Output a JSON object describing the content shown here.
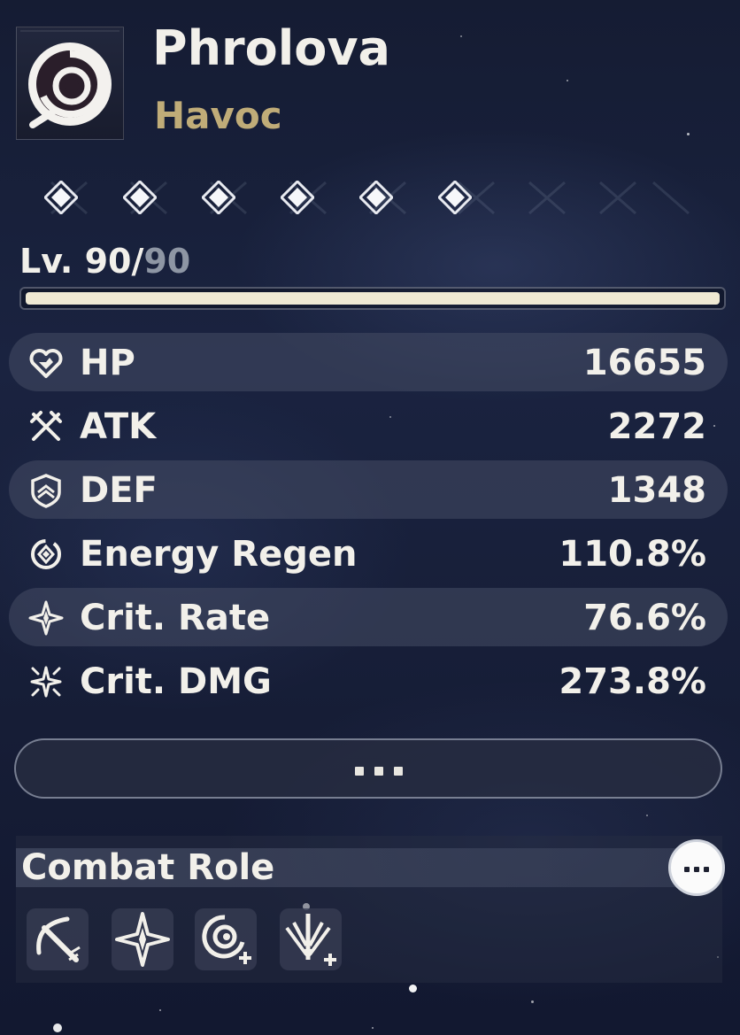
{
  "character": {
    "name": "Phrolova",
    "element": "Havoc",
    "element_icon": "havoc-swirl-icon"
  },
  "sequence": {
    "nodes_unlocked": 6,
    "icon": "diamond-icon"
  },
  "level": {
    "prefix": "Lv. ",
    "current": "90",
    "separator": "/",
    "max": "90",
    "progress": 1.0
  },
  "stats": [
    {
      "label": "HP",
      "value": "16655",
      "icon": "heart-icon",
      "shaded": true
    },
    {
      "label": "ATK",
      "value": "2272",
      "icon": "crossed-swords-icon",
      "shaded": false
    },
    {
      "label": "DEF",
      "value": "1348",
      "icon": "shield-icon",
      "shaded": true
    },
    {
      "label": "Energy Regen",
      "value": "110.8%",
      "icon": "energy-regen-icon",
      "shaded": false
    },
    {
      "label": "Crit. Rate",
      "value": "76.6%",
      "icon": "four-point-star-icon",
      "shaded": true
    },
    {
      "label": "Crit. DMG",
      "value": "273.8%",
      "icon": "burst-star-icon",
      "shaded": false
    }
  ],
  "more_button": {
    "label": "more-stats",
    "icon": "ellipsis-icon"
  },
  "combat_role": {
    "title": "Combat Role",
    "more_icon": "ellipsis-icon",
    "icons": [
      "sword-slash-icon",
      "sparkle-star-icon",
      "havoc-plus-icon",
      "downward-blade-plus-icon"
    ]
  },
  "colors": {
    "element_gold": "#c0ac78",
    "text": "#f2f0ea",
    "level_max": "#8e96a4",
    "level_fill": "#efe9d3"
  }
}
